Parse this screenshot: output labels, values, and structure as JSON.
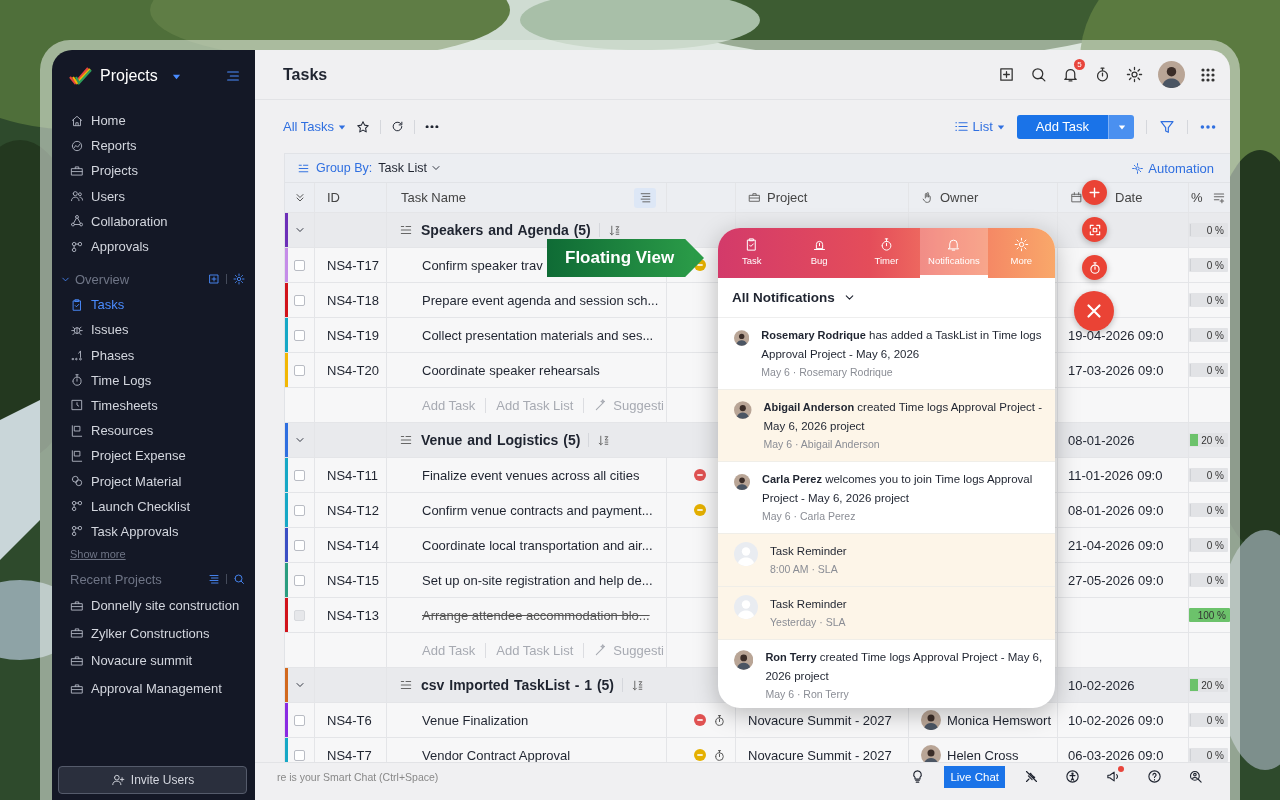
{
  "sidebar": {
    "app_title": "Projects",
    "items": [
      {
        "label": "Home",
        "selected": false
      },
      {
        "label": "Reports",
        "selected": false
      },
      {
        "label": "Projects",
        "selected": false
      },
      {
        "label": "Users",
        "selected": false
      },
      {
        "label": "Collaboration",
        "selected": false
      },
      {
        "label": "Approvals",
        "selected": false
      }
    ],
    "overview": {
      "title": "Overview",
      "expanded": true,
      "items": [
        {
          "label": "Tasks",
          "selected": true
        },
        {
          "label": "Issues",
          "selected": false
        },
        {
          "label": "Phases",
          "selected": false
        },
        {
          "label": "Time Logs",
          "selected": false
        },
        {
          "label": "Timesheets",
          "selected": false
        },
        {
          "label": "Resources",
          "selected": false
        },
        {
          "label": "Project Expense",
          "selected": false
        },
        {
          "label": "Project Material",
          "selected": false
        },
        {
          "label": "Launch Checklist",
          "selected": false
        },
        {
          "label": "Task Approvals",
          "selected": false
        }
      ]
    },
    "show_more": "Show more",
    "recent": {
      "title": "Recent Projects",
      "items": [
        "Donnelly site construction",
        "Zylker Constructions",
        "Novacure summit",
        "Approval Management"
      ]
    },
    "invite_button": "Invite Users"
  },
  "header": {
    "title": "Tasks",
    "notification_badge": "5"
  },
  "toolbar": {
    "view": "All Tasks",
    "layout": "List",
    "add_button": "Add Task"
  },
  "group_by": {
    "label": "Group By:",
    "value": "Task List",
    "automation": "Automation"
  },
  "table": {
    "columns": [
      {
        "label": "ID"
      },
      {
        "label": "Task Name"
      },
      {
        "label": "Project"
      },
      {
        "label": "Owner"
      },
      {
        "label": "Date"
      },
      {
        "label": "%"
      }
    ],
    "rows": [
      {
        "kind": "group",
        "name": "Speakers and Agenda (5)",
        "color": "#6d2fb8",
        "progress": {
          "label": "0 %",
          "level": 0
        }
      },
      {
        "kind": "task",
        "id": "NS4-T17",
        "name": "Confirm speaker trav",
        "color": "#c58ce8",
        "checked": false,
        "status": {
          "color": "#e5b000"
        },
        "progress": {
          "label": "0 %",
          "level": 0
        }
      },
      {
        "kind": "task",
        "id": "NS4-T18",
        "name": "Prepare event agenda and session sch...",
        "color": "#d1131b",
        "checked": false,
        "progress": {
          "label": "0 %",
          "level": 0
        }
      },
      {
        "kind": "task",
        "id": "NS4-T19",
        "name": "Collect presentation materials and ses...",
        "color": "#16a8c6",
        "checked": false,
        "date": "19-04-2026 09:0",
        "progress": {
          "label": "0 %",
          "level": 0
        }
      },
      {
        "kind": "task",
        "id": "NS4-T20",
        "name": "Coordinate speaker rehearsals",
        "color": "#f2b705",
        "checked": false,
        "date": "17-03-2026 09:0",
        "progress": {
          "label": "0 %",
          "level": 0
        }
      },
      {
        "kind": "add",
        "add_task": "Add Task",
        "add_list": "Add Task List",
        "suggestions": "Suggesti"
      },
      {
        "kind": "group",
        "name": "Venue and Logistics (5)",
        "color": "#2f6fe0",
        "date": "08-01-2026",
        "progress": {
          "label": "20 %",
          "level": 0.2
        }
      },
      {
        "kind": "task",
        "id": "NS4-T11",
        "name": "Finalize event venues across all cities",
        "color": "#16a8c6",
        "checked": false,
        "status": {
          "color": "#e05252"
        },
        "date": "11-01-2026 09:0",
        "progress": {
          "label": "0 %",
          "level": 0
        }
      },
      {
        "kind": "task",
        "id": "NS4-T12",
        "name": "Confirm venue contracts and payment...",
        "color": "#16a8c6",
        "checked": false,
        "status": {
          "color": "#e5b000"
        },
        "date": "08-01-2026 09:0",
        "progress": {
          "label": "0 %",
          "level": 0
        }
      },
      {
        "kind": "task",
        "id": "NS4-T14",
        "name": "Coordinate local transportation and air...",
        "color": "#3b4fc4",
        "checked": false,
        "date": "21-04-2026 09:0",
        "progress": {
          "label": "0 %",
          "level": 0
        }
      },
      {
        "kind": "task",
        "id": "NS4-T15",
        "name": "Set up on-site registration and help de...",
        "color": "#2a9d7f",
        "checked": false,
        "date": "27-05-2026 09:0",
        "progress": {
          "label": "0 %",
          "level": 0
        }
      },
      {
        "kind": "task",
        "id": "NS4-T13",
        "name": "Arrange attendee accommodation blo...",
        "color": "#d1131b",
        "checked": false,
        "done": true,
        "progress": {
          "label": "100 %",
          "level": 1
        }
      },
      {
        "kind": "add",
        "add_task": "Add Task",
        "add_list": "Add Task List",
        "suggestions": "Suggesti"
      },
      {
        "kind": "group",
        "name": "csv Imported TaskList - 1 (5)",
        "color": "#d2691e",
        "date": "10-02-2026",
        "progress": {
          "label": "20 %",
          "level": 0.2
        }
      },
      {
        "kind": "task",
        "id": "NS4-T6",
        "name": "Venue Finalization",
        "color": "#8a2be2",
        "checked": false,
        "status": {
          "color": "#e05252"
        },
        "timer": true,
        "project": "Novacure Summit - 2027",
        "owner": "Monica Hemswort",
        "date": "10-02-2026 09:0",
        "progress": {
          "label": "0 %",
          "level": 0
        }
      },
      {
        "kind": "task",
        "id": "NS4-T7",
        "name": "Vendor Contract Approval",
        "color": "#16a8c6",
        "checked": false,
        "status": {
          "color": "#e5b000"
        },
        "timer": true,
        "project": "Novacure Summit - 2027",
        "owner": "Helen Cross",
        "date": "06-03-2026 09:0",
        "progress": {
          "label": "0 %",
          "level": 0
        }
      }
    ]
  },
  "floating_label": "Floating View",
  "panel": {
    "tabs": [
      {
        "label": "Task",
        "selected": false
      },
      {
        "label": "Bug",
        "selected": false
      },
      {
        "label": "Timer",
        "selected": false
      },
      {
        "label": "Notifications",
        "selected": true
      },
      {
        "label": "More",
        "selected": false
      }
    ],
    "filter": "All Notifications",
    "items": [
      {
        "message": "**Rosemary Rodrique** has added a TaskList in Time logs Approval Project - May 6, 2026",
        "meta": "May 6 · Rosemary Rodrique",
        "unread": false,
        "kind": "person"
      },
      {
        "message": "**Abigail Anderson** created Time logs Approval Project - May 6, 2026 project",
        "meta": "May 6 · Abigail Anderson",
        "unread": true,
        "kind": "person"
      },
      {
        "message": "**Carla Perez** welcomes you to join Time logs Approval Project - May 6, 2026 project",
        "meta": "May 6 · Carla Perez",
        "unread": false,
        "kind": "person"
      },
      {
        "message": "Task Reminder",
        "meta": "8:00 AM · SLA",
        "unread": true,
        "kind": "reminder"
      },
      {
        "message": "Task Reminder",
        "meta": "Yesterday · SLA",
        "unread": true,
        "kind": "reminder"
      },
      {
        "message": "**Ron Terry** created Time logs Approval Project - May 6, 2026 project",
        "meta": "May 6 · Ron Terry",
        "unread": false,
        "kind": "person"
      }
    ]
  },
  "status_bar": {
    "hint": "re is your Smart Chat (Ctrl+Space)",
    "live_chat": "Live Chat"
  }
}
